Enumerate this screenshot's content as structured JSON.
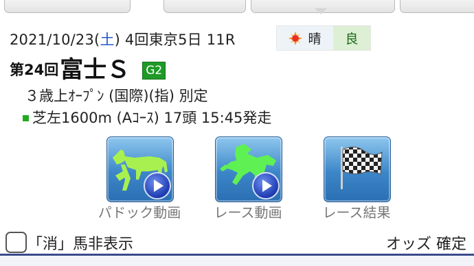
{
  "race": {
    "date_prefix": "2021/10/23(",
    "weekday": "土",
    "date_suffix": ")",
    "meeting": " 4回東京5日 11R",
    "weather": "晴",
    "track_condition": "良",
    "title_prefix": "第24回",
    "title_name": "富士Ｓ",
    "grade": "G2",
    "conditions": "３歳上ｵｰﾌﾟﾝ (国際)(指) 別定",
    "course": "芝左1600m (Aｺｰｽ) 17頭 15:45発走"
  },
  "media": [
    {
      "label": "パドック動画",
      "icon": "paddock-horse-icon"
    },
    {
      "label": "レース動画",
      "icon": "racing-horse-icon"
    },
    {
      "label": "レース結果",
      "icon": "checkered-flag-icon"
    }
  ],
  "bottom": {
    "hide_label": "「消」馬非表示",
    "odds_label": "オッズ 確定"
  },
  "colors": {
    "grade_bg": "#1f9a27",
    "button_blue": "#3c86c8",
    "horse_green": "#9cf03c",
    "saturday_blue": "#2255cc"
  }
}
